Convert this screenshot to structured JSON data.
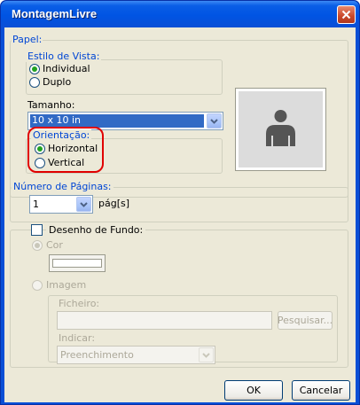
{
  "window": {
    "title": "MontagemLivre"
  },
  "papel": {
    "label": "Papel:",
    "estilo_label": "Estilo de Vista:",
    "estilo_options": [
      {
        "label": "Individual",
        "checked": true
      },
      {
        "label": "Duplo",
        "checked": false
      }
    ],
    "tamanho_label": "Tamanho:",
    "tamanho_value": "10 x 10 in",
    "orientacao_label": "Orientação:",
    "orientacao_options": [
      {
        "label": "Horizontal",
        "checked": true
      },
      {
        "label": "Vertical",
        "checked": false
      }
    ]
  },
  "paginas": {
    "label": "Número de Páginas:",
    "value": "1",
    "unit": "pág[s]"
  },
  "fundo": {
    "label": "Desenho de Fundo:",
    "checked": false,
    "cor_label": "Cor",
    "cor_swatch": "#ffffff",
    "imagem_label": "Imagem",
    "ficheiro_label": "Ficheiro:",
    "ficheiro_value": "",
    "pesquisar_label": "Pesquisar...",
    "indicar_label": "Indicar:",
    "indicar_value": "Preenchimento"
  },
  "preview": {
    "icon": "person-silhouette-icon"
  },
  "buttons": {
    "ok": "OK",
    "cancel": "Cancelar"
  },
  "colors": {
    "title_bar": "#0054e3",
    "dialog_bg": "#ece9d8",
    "group_label": "#0046d5",
    "selection": "#316ac5",
    "highlight_ring": "#e00000"
  }
}
